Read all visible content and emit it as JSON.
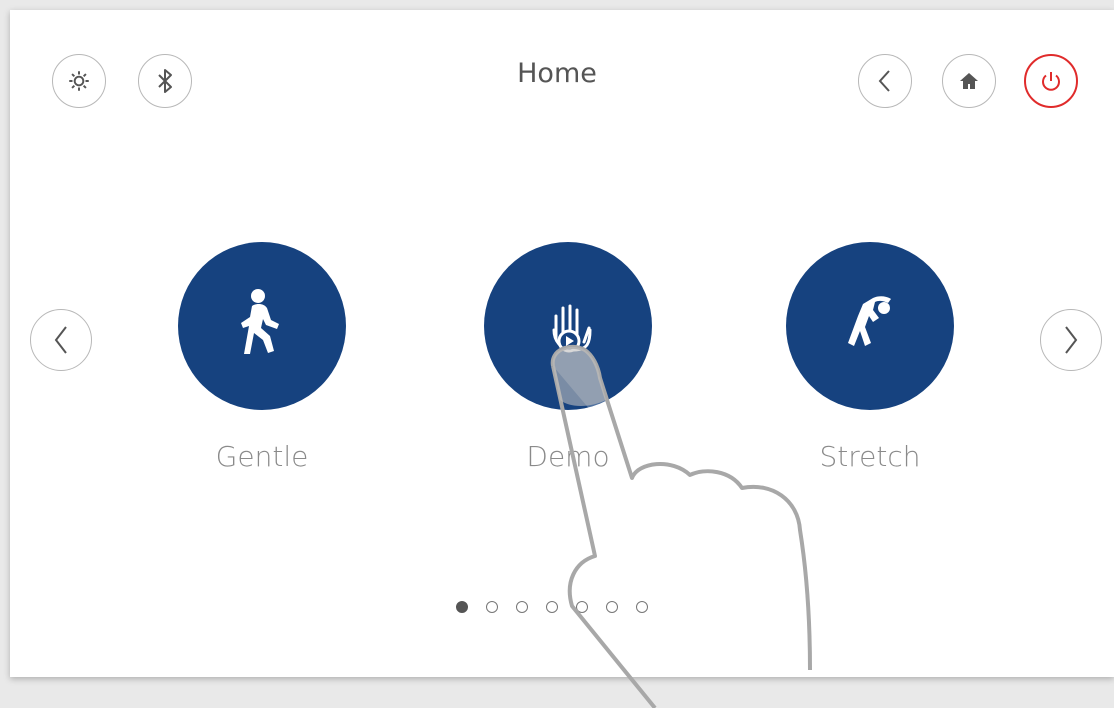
{
  "header": {
    "title": "Home",
    "left_buttons": [
      {
        "name": "settings",
        "icon": "gear-icon"
      },
      {
        "name": "bluetooth",
        "icon": "bluetooth-icon"
      }
    ],
    "right_buttons": [
      {
        "name": "back",
        "icon": "chevron-left-icon"
      },
      {
        "name": "home",
        "icon": "home-icon"
      },
      {
        "name": "power",
        "icon": "power-icon",
        "color": "#e02b2b"
      }
    ]
  },
  "carousel": {
    "tiles": [
      {
        "label": "Gentle",
        "icon": "walking-person-icon"
      },
      {
        "label": "Demo",
        "icon": "hand-touch-icon"
      },
      {
        "label": "Stretch",
        "icon": "stretching-person-icon"
      }
    ],
    "prev_icon": "chevron-left-icon",
    "next_icon": "chevron-right-icon",
    "page_count": 7,
    "active_page": 1
  },
  "colors": {
    "tile": "#16427f",
    "power": "#e02b2b",
    "background": "#ffffff"
  }
}
